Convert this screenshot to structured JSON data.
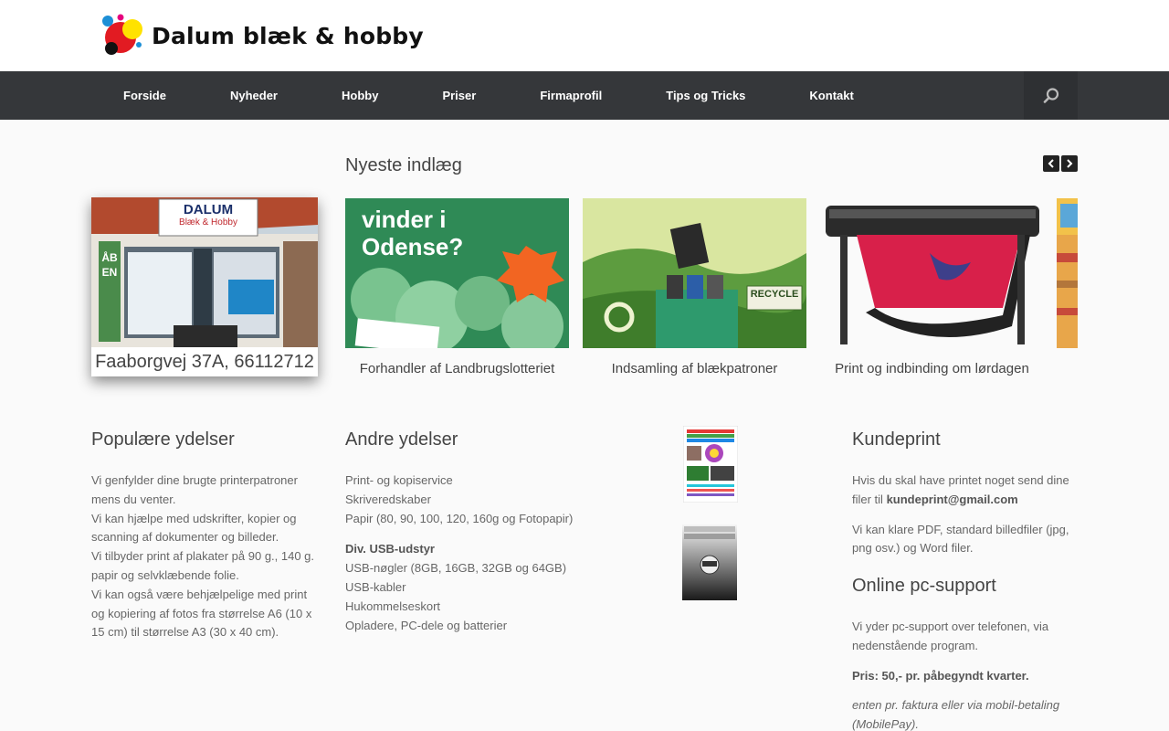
{
  "header": {
    "logo_text": "Dalum blæk & hobby"
  },
  "nav": {
    "items": [
      "Forside",
      "Nyheder",
      "Hobby",
      "Priser",
      "Firmaprofil",
      "Tips og Tricks",
      "Kontakt"
    ]
  },
  "featured": {
    "caption": "Faaborgvej 37A, 66112712",
    "sign_line1": "DALUM",
    "sign_line2": "Blæk & Hobby",
    "door_text": "ÅBEN"
  },
  "latest": {
    "heading": "Nyeste indlæg",
    "posts": [
      {
        "title": "Forhandler af Landbrugslotteriet",
        "img_text": "vinder i Odense?"
      },
      {
        "title": "Indsamling af blækpatroner",
        "img_text": "RECYCLE"
      },
      {
        "title": "Print og indbinding om lørdagen"
      }
    ]
  },
  "popular": {
    "heading": "Populære ydelser",
    "lines": [
      "Vi genfylder dine brugte printerpatroner mens du venter.",
      "Vi kan hjælpe med udskrifter, kopier og scanning af dokumenter og billeder.",
      "Vi tilbyder print af plakater på 90 g., 140 g. papir og selvklæbende folie.",
      "Vi kan også være behjælpelige med print og kopiering af fotos fra størrelse A6 (10 x 15 cm) til størrelse A3 (30 x 40 cm)."
    ]
  },
  "other": {
    "heading": "Andre ydelser",
    "group1": [
      "Print- og kopiservice",
      "Skriveredskaber",
      "Papir (80, 90, 100, 120, 160g og Fotopapir)"
    ],
    "group2_title": "Div. USB-udstyr",
    "group2": [
      "USB-nøgler (8GB, 16GB, 32GB og 64GB)",
      "USB-kabler",
      "Hukommelseskort",
      "Opladere, PC-dele og batterier"
    ]
  },
  "kundeprint": {
    "heading": "Kundeprint",
    "text1": "Hvis du skal have printet noget send dine filer til ",
    "email": "kundeprint@gmail.com",
    "text2": "Vi kan klare PDF, standard billedfiler (jpg, png osv.) og Word filer."
  },
  "support": {
    "heading": "Online pc-support",
    "text1": "Vi yder pc-support over telefonen, via nedenstående program.",
    "price": "Pris: 50,- pr. påbegyndt kvarter.",
    "payment": "enten pr. faktura eller via mobil-betaling (MobilePay)."
  },
  "colors": {
    "nav_bg": "#35373a",
    "text": "#666666",
    "heading": "#444444"
  }
}
